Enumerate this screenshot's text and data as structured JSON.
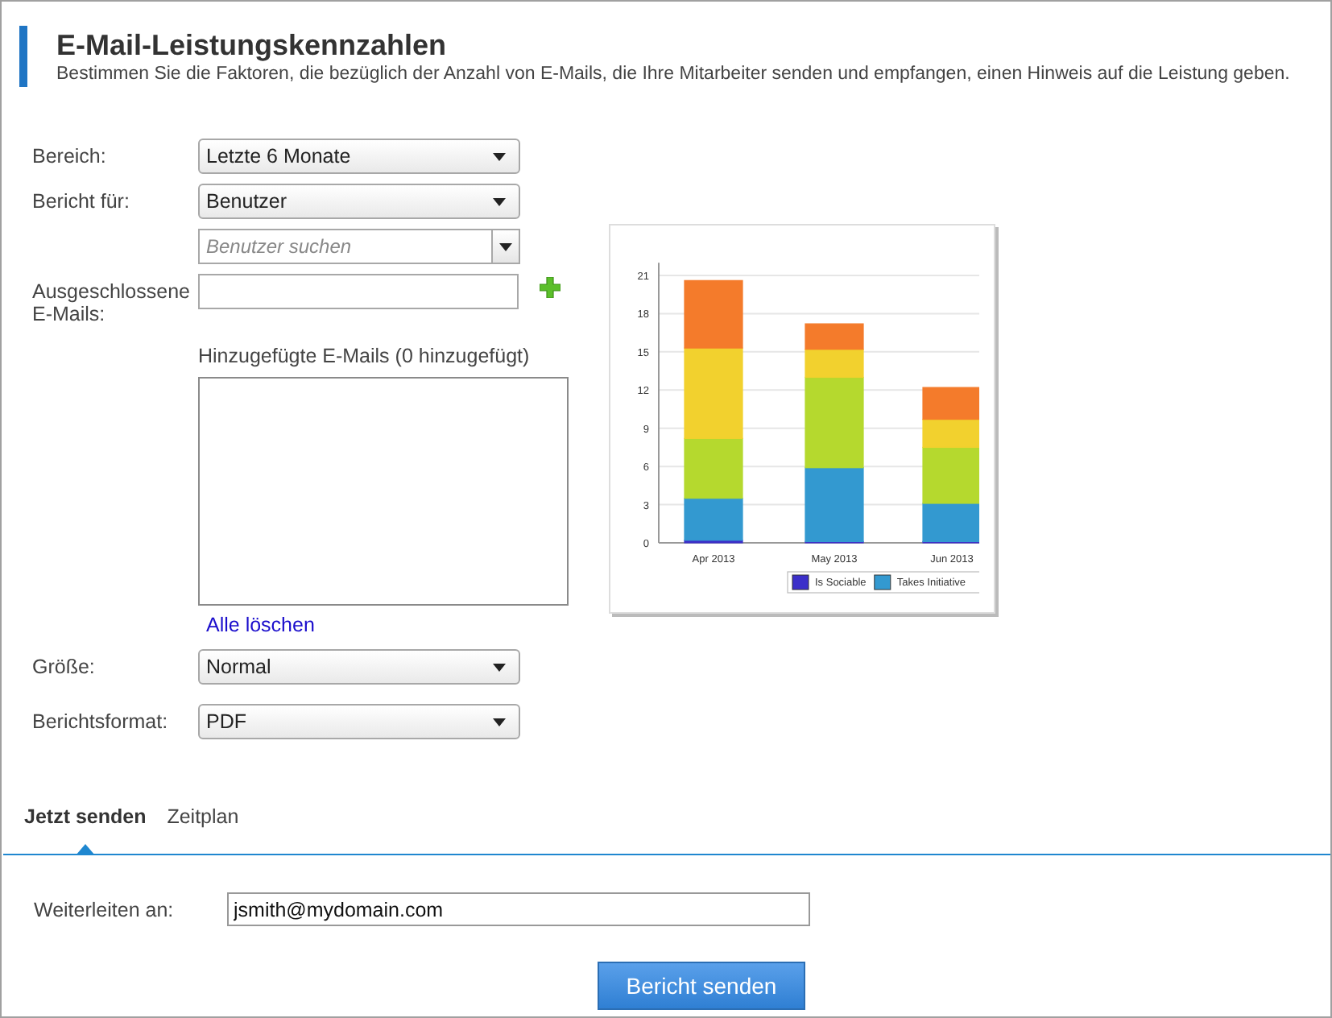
{
  "header": {
    "title": "E-Mail-Leistungskennzahlen",
    "description": "Bestimmen Sie die Faktoren, die bezüglich der Anzahl von E-Mails, die Ihre Mitarbeiter senden und empfangen, einen Hinweis auf die Leistung geben."
  },
  "form": {
    "range": {
      "label": "Bereich:",
      "value": "Letzte 6 Monate"
    },
    "report_for": {
      "label": "Bericht für:",
      "value": "Benutzer"
    },
    "user_search": {
      "placeholder": "Benutzer suchen"
    },
    "excluded": {
      "label": "Ausgeschlossene E-Mails:"
    },
    "added_caption": "Hinzugefügte E-Mails (0 hinzugefügt)",
    "clear_link": "Alle löschen",
    "size": {
      "label": "Größe:",
      "value": "Normal"
    },
    "format": {
      "label": "Berichtsformat:",
      "value": "PDF"
    }
  },
  "preview": {
    "chart_data": {
      "type": "bar",
      "stacked": true,
      "categories": [
        "Apr 2013",
        "May 2013",
        "Jun 2013"
      ],
      "yticks": [
        0,
        3,
        6,
        9,
        12,
        15,
        18,
        21
      ],
      "ylim": [
        0,
        22
      ],
      "grid": true,
      "legend": true,
      "series": [
        {
          "name": "Is Sociable",
          "color": "#3b2fc9",
          "values": [
            0.2,
            0.1,
            0.1
          ]
        },
        {
          "name": "Takes Initiative",
          "color": "#3399d0",
          "values": [
            3.3,
            5.8,
            3.0
          ]
        },
        {
          "color": "#b5d92e",
          "values": [
            4.7,
            7.1,
            4.4
          ]
        },
        {
          "color": "#f2d12e",
          "values": [
            7.1,
            2.2,
            2.2
          ]
        },
        {
          "color": "#f47b2b",
          "values": [
            5.3,
            2.0,
            2.5
          ]
        }
      ]
    }
  },
  "tabs": [
    {
      "label": "Jetzt senden",
      "selected": true
    },
    {
      "label": "Zeitplan",
      "selected": false
    }
  ],
  "send": {
    "label": "Weiterleiten an:",
    "value": "jsmith@mydomain.com",
    "button": "Bericht senden"
  }
}
